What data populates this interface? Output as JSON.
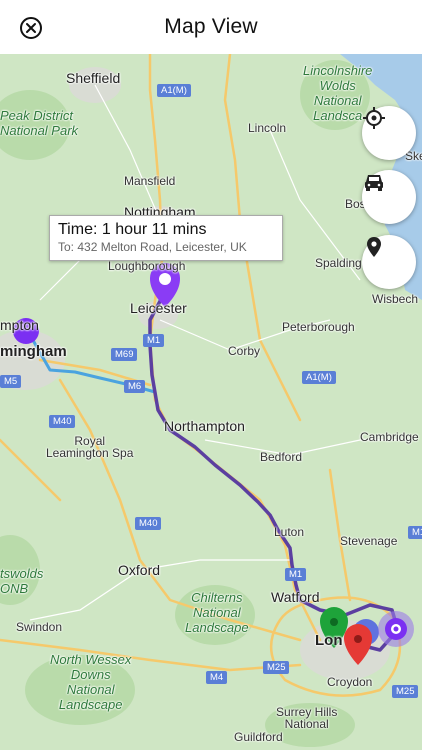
{
  "header": {
    "title": "Map View",
    "close_icon": "close-circle-icon"
  },
  "callout": {
    "time": "Time: 1 hour 11 mins",
    "destination": "To: 432 Melton Road, Leicester, UK"
  },
  "map_controls": [
    {
      "name": "locate-me-button",
      "icon": "crosshair-icon"
    },
    {
      "name": "drive-mode-button",
      "icon": "car-icon"
    },
    {
      "name": "location-pin-button",
      "icon": "map-pin-icon"
    }
  ],
  "labels": {
    "sheffield": "Sheffield",
    "peak_district_1": "Peak District",
    "peak_district_2": "National Park",
    "lincolnshire_1": "Lincolnshire",
    "lincolnshire_2": "Wolds",
    "lincolnshire_3": "National",
    "lincolnshire_4": "Landsca",
    "lincoln": "Lincoln",
    "skeg": "Ske",
    "mansfield": "Mansfield",
    "nottingham": "Nottingham",
    "boston": "Bos",
    "loughborough": "Loughborough",
    "spalding": "Spalding",
    "wisbech": "Wisbech",
    "leicester": "Leicester",
    "hampton": "mpton",
    "birmingham": "mingham",
    "peterborough": "Peterborough",
    "corby": "Corby",
    "northampton": "Northampton",
    "cambridge": "Cambridge",
    "royal_1": "Royal",
    "royal_2": "Leamington Spa",
    "bedford": "Bedford",
    "luton": "Luton",
    "stevenage": "Stevenage",
    "oxford": "Oxford",
    "cotswolds_1": "tswolds",
    "cotswolds_2": "ONB",
    "chilterns_1": "Chilterns",
    "chilterns_2": "National",
    "chilterns_3": "Landscape",
    "watford": "Watford",
    "swindon": "Swindon",
    "london": "Lon",
    "north_wessex_1": "North Wessex",
    "north_wessex_2": "Downs",
    "north_wessex_3": "National",
    "north_wessex_4": "Landscape",
    "croydon": "Croydon",
    "surrey_1": "Surrey Hills",
    "surrey_2": "National",
    "guildford": "Guildford",
    "num_5": "5",
    "num_6": "6"
  },
  "roads": {
    "a1m_north": "A1(M)",
    "m69": "M69",
    "m1_leicester": "M1",
    "m6": "M6",
    "a1m_south": "A1(M)",
    "m40_north": "M40",
    "m40_south": "M40",
    "m1_luton": "M1",
    "m11": "M11",
    "m25_west": "M25",
    "m25_east": "M25",
    "m4": "M4",
    "m5": "M5"
  },
  "colors": {
    "land": "#cfe6c4",
    "route": "#5b3fa0",
    "route_alt": "#4aa3df",
    "marker_purple": "#7b2ff2",
    "marker_green": "#1ea33a",
    "marker_red": "#e53935",
    "motorway": "#f5c96b"
  }
}
